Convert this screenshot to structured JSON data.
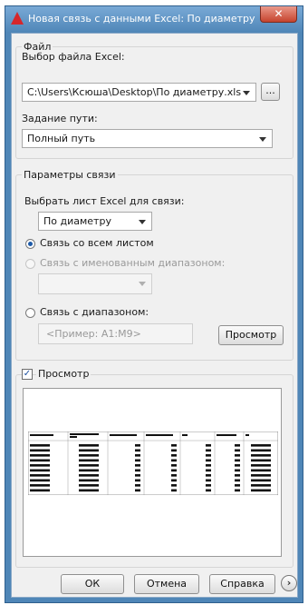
{
  "window": {
    "title": "Новая связь с данными Excel: По диаметру",
    "close_glyph": "✕"
  },
  "file_group": {
    "legend": "Файл",
    "select_label": "Выбор файла Excel:",
    "file_path": "C:\\Users\\Ксюша\\Desktop\\По диаметру.xls",
    "browse_label": "...",
    "path_label": "Задание пути:",
    "path_value": "Полный путь"
  },
  "link_group": {
    "legend": "Параметры связи",
    "sheet_label": "Выбрать лист Excel для связи:",
    "sheet_value": "По диаметру",
    "option_whole_sheet": "Связь со всем листом",
    "option_named_range": "Связь с именованным диапазоном:",
    "option_range": "Связь с диапазоном:",
    "range_placeholder": "<Пример: A1:M9>",
    "preview_range_button": "Просмотр",
    "selected_option": "whole_sheet"
  },
  "preview_group": {
    "checkbox_label": "Просмотр",
    "checked": true
  },
  "buttons": {
    "ok": "ОК",
    "cancel": "Отмена",
    "help": "Справка",
    "more_glyph": "›"
  }
}
